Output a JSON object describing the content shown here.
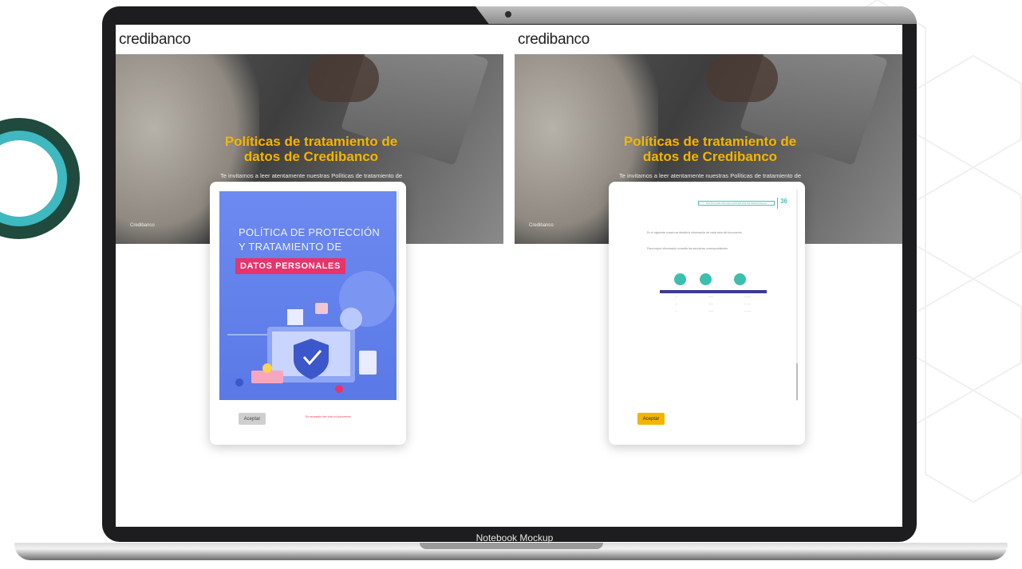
{
  "mockup_label": "Notebook Mockup",
  "panels": [
    {
      "logo": "credibanco",
      "hero_title": "Políticas de tratamiento de datos de Credibanco",
      "hero_subtitle": "Te invitamos a leer atentamente nuestras Políticas de tratamiento de datos para poder avanzar con el registro.",
      "hero_footer": "Credibanco",
      "document": {
        "title_line1": "POLÍTICA DE PROTECCIÓN",
        "title_line2": "Y TRATAMIENTO DE",
        "badge": "DATOS PERSONALES"
      },
      "accept_button": "Aceptar",
      "note": "Es necesario leer todo el documento"
    },
    {
      "logo": "credibanco",
      "hero_title": "Políticas de tratamiento de datos de Credibanco",
      "hero_subtitle": "Te invitamos a leer atentamente nuestras Políticas de tratamiento de datos para poder avanzar con el registro.",
      "hero_footer": "Credibanco",
      "page": {
        "header": "POLÍTICA DE PROTECCIÓN DE DATOS PERSONALES",
        "number": "36",
        "paragraph1": "En el siguiente cuadro se detalla la información de cada área del documento.",
        "paragraph2": "Para mayor información consulte las secciones correspondientes."
      },
      "accept_button": "Aceptar"
    }
  ],
  "colors": {
    "accent_yellow": "#f5b400",
    "cover_blue": "#5a79e6",
    "badge_pink": "#e8336b",
    "teal": "#3dbfb0"
  }
}
